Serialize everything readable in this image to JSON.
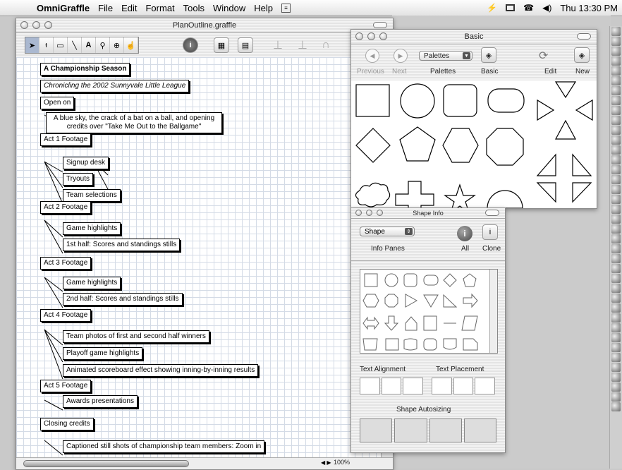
{
  "menubar": {
    "app_name": "OmniGraffle",
    "items": [
      "File",
      "Edit",
      "Format",
      "Tools",
      "Window",
      "Help"
    ],
    "clock": "Thu 13:30 PM"
  },
  "main_window": {
    "title": "PlanOutline.graffle",
    "zoom": "100%",
    "tools": [
      "select-icon",
      "text-cursor-icon",
      "rectangle-icon",
      "line-icon",
      "text-icon",
      "stamp-icon",
      "zoom-icon",
      "hand-icon"
    ]
  },
  "outline": [
    {
      "id": "n0",
      "text": "A Championship Season",
      "style": "bold"
    },
    {
      "id": "n1",
      "text": "Chronicling the 2002 Sunnyvale Little League",
      "style": "italic"
    },
    {
      "id": "n2",
      "text": "Open on"
    },
    {
      "id": "n3",
      "text": "A blue sky, the crack of a bat on a ball, and opening credits over \"Take Me Out to the Ballgame\""
    },
    {
      "id": "n4",
      "text": "Act 1 Footage"
    },
    {
      "id": "n5",
      "text": "Signup desk"
    },
    {
      "id": "n6",
      "text": "Tryouts"
    },
    {
      "id": "n7",
      "text": "Team selections"
    },
    {
      "id": "n8",
      "text": "Act 2 Footage"
    },
    {
      "id": "n9",
      "text": "Game highlights"
    },
    {
      "id": "n10",
      "text": "1st half: Scores and standings stills"
    },
    {
      "id": "n11",
      "text": "Act 3 Footage"
    },
    {
      "id": "n12",
      "text": "Game highlights"
    },
    {
      "id": "n13",
      "text": "2nd half: Scores and standings stills"
    },
    {
      "id": "n14",
      "text": "Act 4 Footage"
    },
    {
      "id": "n15",
      "text": "Team photos of first and second half winners"
    },
    {
      "id": "n16",
      "text": "Playoff game highlights"
    },
    {
      "id": "n17",
      "text": "Animated scoreboard effect showing inning-by-inning results"
    },
    {
      "id": "n18",
      "text": "Act 5 Footage"
    },
    {
      "id": "n19",
      "text": "Awards presentations"
    },
    {
      "id": "n20",
      "text": "Closing credits"
    },
    {
      "id": "n21",
      "text": "Captioned still shots of championship team members: Zoom in"
    }
  ],
  "basic_palette": {
    "title": "Basic",
    "previous": "Previous",
    "next": "Next",
    "palettes_popup": "Palettes",
    "palettes_label": "Palettes",
    "basic_label": "Basic",
    "edit": "Edit",
    "new": "New",
    "shapes": [
      "square",
      "circle",
      "rounded-rectangle",
      "pill",
      "triangles",
      "diamond",
      "pentagon",
      "hexagon",
      "octagon",
      "right-triangles",
      "cloud",
      "cross",
      "star",
      "half-circle"
    ]
  },
  "shape_info": {
    "title": "Shape Info",
    "popup": "Shape",
    "info_panes": "Info Panes",
    "all": "All",
    "clone": "Clone",
    "text_alignment": "Text Alignment",
    "text_placement": "Text Placement",
    "shape_autosizing": "Shape Autosizing"
  }
}
